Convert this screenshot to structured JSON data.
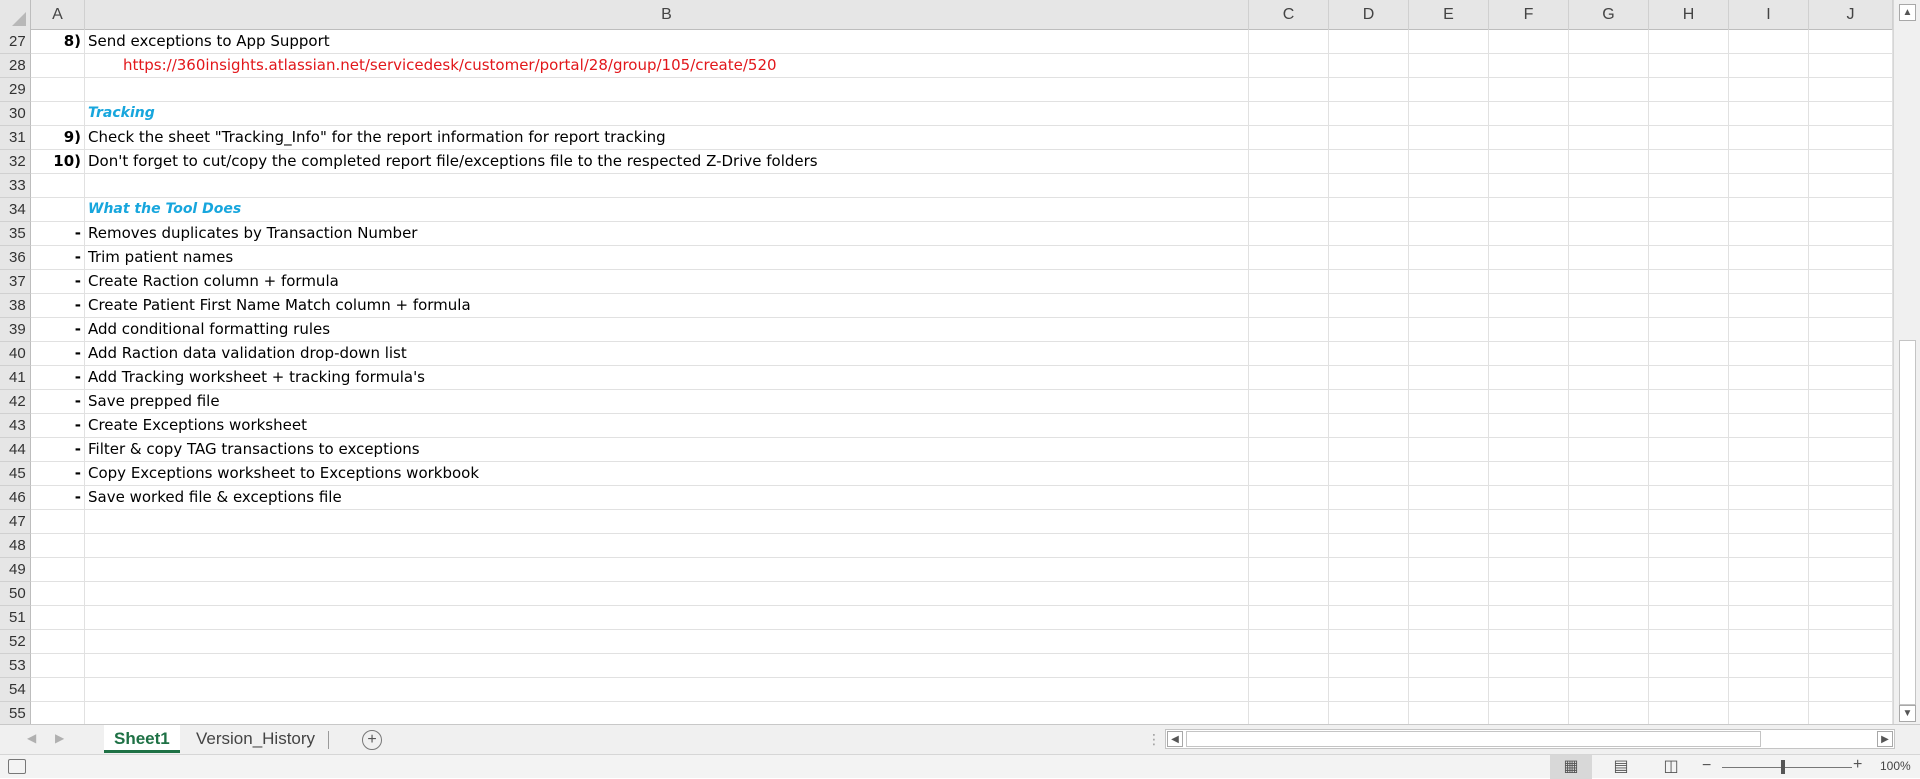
{
  "columns": [
    "A",
    "B",
    "C",
    "D",
    "E",
    "F",
    "G",
    "H",
    "I",
    "J"
  ],
  "rows": [
    {
      "num": "27",
      "a": "8)",
      "b": "Send exceptions to App Support",
      "style": ""
    },
    {
      "num": "28",
      "a": "",
      "b": "https://360insights.atlassian.net/servicedesk/customer/portal/28/group/105/create/520",
      "style": "link"
    },
    {
      "num": "29",
      "a": "",
      "b": "",
      "style": ""
    },
    {
      "num": "30",
      "a": "",
      "b": "Tracking",
      "style": "heading"
    },
    {
      "num": "31",
      "a": "9)",
      "b": "Check the sheet \"Tracking_Info\" for the report information for report tracking",
      "style": ""
    },
    {
      "num": "32",
      "a": "10)",
      "b": "Don't forget to cut/copy the completed report file/exceptions file to the respected Z-Drive folders",
      "style": ""
    },
    {
      "num": "33",
      "a": "",
      "b": "",
      "style": ""
    },
    {
      "num": "34",
      "a": "",
      "b": "What the Tool Does",
      "style": "heading"
    },
    {
      "num": "35",
      "a": "-",
      "b": "Removes duplicates by Transaction Number",
      "style": ""
    },
    {
      "num": "36",
      "a": "-",
      "b": "Trim patient names",
      "style": ""
    },
    {
      "num": "37",
      "a": "-",
      "b": "Create Raction column + formula",
      "style": ""
    },
    {
      "num": "38",
      "a": "-",
      "b": "Create Patient First Name Match column + formula",
      "style": ""
    },
    {
      "num": "39",
      "a": "-",
      "b": "Add conditional formatting rules",
      "style": ""
    },
    {
      "num": "40",
      "a": "-",
      "b": "Add Raction data validation drop-down list",
      "style": ""
    },
    {
      "num": "41",
      "a": "-",
      "b": "Add Tracking worksheet + tracking formula's",
      "style": ""
    },
    {
      "num": "42",
      "a": "-",
      "b": "Save prepped file",
      "style": ""
    },
    {
      "num": "43",
      "a": "-",
      "b": "Create Exceptions worksheet",
      "style": ""
    },
    {
      "num": "44",
      "a": "-",
      "b": "Filter & copy TAG transactions to exceptions",
      "style": ""
    },
    {
      "num": "45",
      "a": "-",
      "b": "Copy Exceptions worksheet to Exceptions workbook",
      "style": ""
    },
    {
      "num": "46",
      "a": "-",
      "b": "Save worked file & exceptions file",
      "style": ""
    },
    {
      "num": "47",
      "a": "",
      "b": "",
      "style": ""
    },
    {
      "num": "48",
      "a": "",
      "b": "",
      "style": ""
    },
    {
      "num": "49",
      "a": "",
      "b": "",
      "style": ""
    },
    {
      "num": "50",
      "a": "",
      "b": "",
      "style": ""
    },
    {
      "num": "51",
      "a": "",
      "b": "",
      "style": ""
    },
    {
      "num": "52",
      "a": "",
      "b": "",
      "style": ""
    },
    {
      "num": "53",
      "a": "",
      "b": "",
      "style": ""
    },
    {
      "num": "54",
      "a": "",
      "b": "",
      "style": ""
    },
    {
      "num": "55",
      "a": "",
      "b": "",
      "style": ""
    }
  ],
  "tabs": {
    "active": "Sheet1",
    "second": "Version_History",
    "add_icon": "plus-circle-icon"
  },
  "status": {
    "zoom": "100%",
    "views": [
      "normal-view-icon",
      "page-layout-icon",
      "page-break-icon"
    ]
  },
  "colors": {
    "link": "#e2171b",
    "heading": "#17a6dd",
    "active_tab": "#1e7145"
  }
}
